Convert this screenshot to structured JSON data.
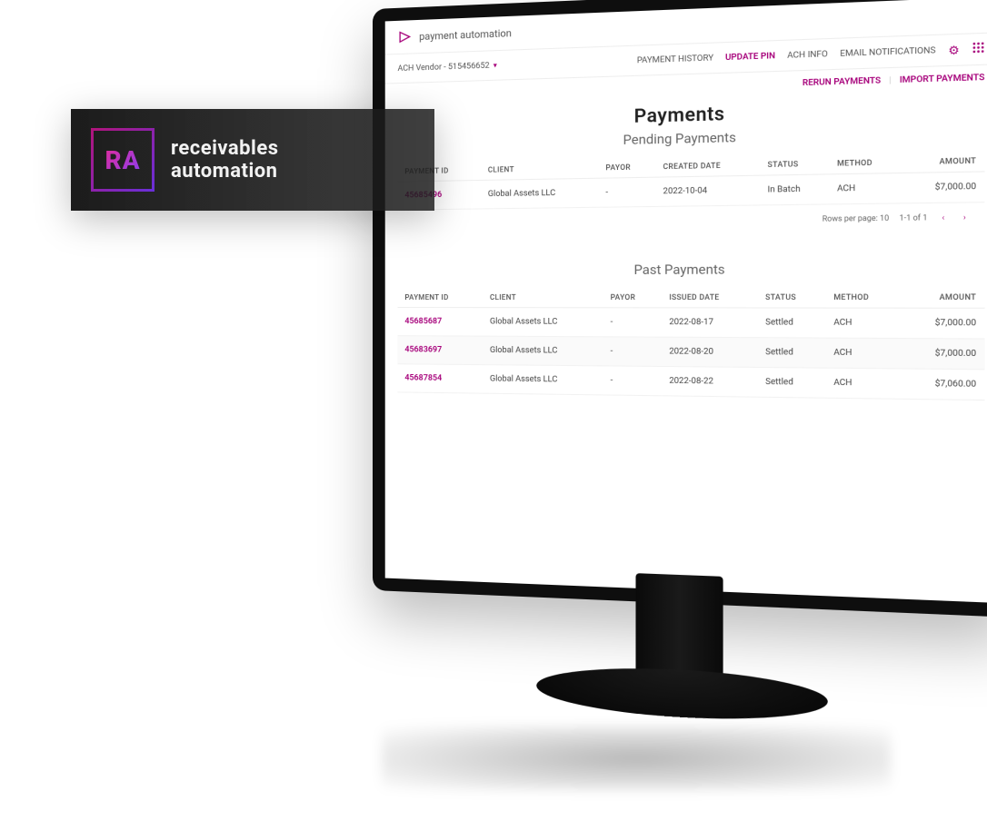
{
  "banner": {
    "badge_text": "RA",
    "line1": "receivables",
    "line2": "automation"
  },
  "header": {
    "app_title": "payment automation"
  },
  "navbar": {
    "vendor_label": "ACH Vendor - 515456652",
    "links": {
      "payment_history": "PAYMENT HISTORY",
      "update_pin": "UPDATE PIN",
      "ach_info": "ACH INFO",
      "email_notifications": "EMAIL NOTIFICATIONS"
    }
  },
  "actions": {
    "rerun": "RERUN PAYMENTS",
    "import": "IMPORT PAYMENTS"
  },
  "page": {
    "title": "Payments"
  },
  "pending": {
    "subtitle": "Pending Payments",
    "columns": {
      "payment_id": "PAYMENT ID",
      "client": "CLIENT",
      "payor": "PAYOR",
      "created_date": "CREATED DATE",
      "status": "STATUS",
      "method": "METHOD",
      "amount": "AMOUNT"
    },
    "rows": [
      {
        "id": "45685496",
        "client": "Global Assets LLC",
        "payor": "-",
        "date": "2022-10-04",
        "status": "In Batch",
        "method": "ACH",
        "amount": "$7,000.00"
      }
    ],
    "pager": {
      "rows_label": "Rows per page: 10",
      "range": "1-1 of 1"
    }
  },
  "past": {
    "subtitle": "Past Payments",
    "columns": {
      "payment_id": "PAYMENT ID",
      "client": "CLIENT",
      "payor": "PAYOR",
      "issued_date": "ISSUED DATE",
      "status": "STATUS",
      "method": "METHOD",
      "amount": "AMOUNT"
    },
    "rows": [
      {
        "id": "45685687",
        "client": "Global Assets LLC",
        "payor": "-",
        "date": "2022-08-17",
        "status": "Settled",
        "method": "ACH",
        "amount": "$7,000.00"
      },
      {
        "id": "45683697",
        "client": "Global Assets LLC",
        "payor": "-",
        "date": "2022-08-20",
        "status": "Settled",
        "method": "ACH",
        "amount": "$7,000.00"
      },
      {
        "id": "45687854",
        "client": "Global Assets LLC",
        "payor": "-",
        "date": "2022-08-22",
        "status": "Settled",
        "method": "ACH",
        "amount": "$7,060.00"
      }
    ]
  },
  "colors": {
    "accent": "#a6007a"
  }
}
